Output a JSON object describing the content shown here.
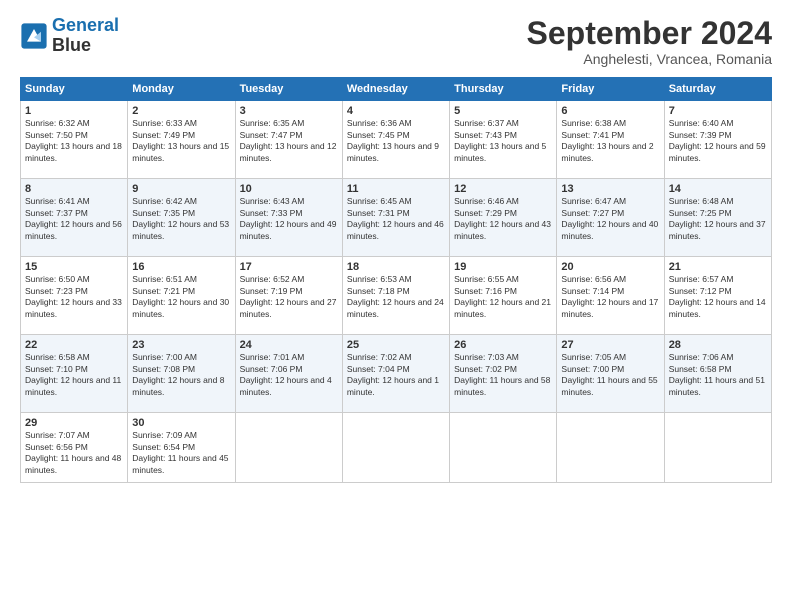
{
  "logo": {
    "line1": "General",
    "line2": "Blue"
  },
  "header": {
    "month": "September 2024",
    "location": "Anghelesti, Vrancea, Romania"
  },
  "weekdays": [
    "Sunday",
    "Monday",
    "Tuesday",
    "Wednesday",
    "Thursday",
    "Friday",
    "Saturday"
  ],
  "weeks": [
    [
      {
        "day": "1",
        "sunrise": "6:32 AM",
        "sunset": "7:50 PM",
        "daylight": "13 hours and 18 minutes."
      },
      {
        "day": "2",
        "sunrise": "6:33 AM",
        "sunset": "7:49 PM",
        "daylight": "13 hours and 15 minutes."
      },
      {
        "day": "3",
        "sunrise": "6:35 AM",
        "sunset": "7:47 PM",
        "daylight": "13 hours and 12 minutes."
      },
      {
        "day": "4",
        "sunrise": "6:36 AM",
        "sunset": "7:45 PM",
        "daylight": "13 hours and 9 minutes."
      },
      {
        "day": "5",
        "sunrise": "6:37 AM",
        "sunset": "7:43 PM",
        "daylight": "13 hours and 5 minutes."
      },
      {
        "day": "6",
        "sunrise": "6:38 AM",
        "sunset": "7:41 PM",
        "daylight": "13 hours and 2 minutes."
      },
      {
        "day": "7",
        "sunrise": "6:40 AM",
        "sunset": "7:39 PM",
        "daylight": "12 hours and 59 minutes."
      }
    ],
    [
      {
        "day": "8",
        "sunrise": "6:41 AM",
        "sunset": "7:37 PM",
        "daylight": "12 hours and 56 minutes."
      },
      {
        "day": "9",
        "sunrise": "6:42 AM",
        "sunset": "7:35 PM",
        "daylight": "12 hours and 53 minutes."
      },
      {
        "day": "10",
        "sunrise": "6:43 AM",
        "sunset": "7:33 PM",
        "daylight": "12 hours and 49 minutes."
      },
      {
        "day": "11",
        "sunrise": "6:45 AM",
        "sunset": "7:31 PM",
        "daylight": "12 hours and 46 minutes."
      },
      {
        "day": "12",
        "sunrise": "6:46 AM",
        "sunset": "7:29 PM",
        "daylight": "12 hours and 43 minutes."
      },
      {
        "day": "13",
        "sunrise": "6:47 AM",
        "sunset": "7:27 PM",
        "daylight": "12 hours and 40 minutes."
      },
      {
        "day": "14",
        "sunrise": "6:48 AM",
        "sunset": "7:25 PM",
        "daylight": "12 hours and 37 minutes."
      }
    ],
    [
      {
        "day": "15",
        "sunrise": "6:50 AM",
        "sunset": "7:23 PM",
        "daylight": "12 hours and 33 minutes."
      },
      {
        "day": "16",
        "sunrise": "6:51 AM",
        "sunset": "7:21 PM",
        "daylight": "12 hours and 30 minutes."
      },
      {
        "day": "17",
        "sunrise": "6:52 AM",
        "sunset": "7:19 PM",
        "daylight": "12 hours and 27 minutes."
      },
      {
        "day": "18",
        "sunrise": "6:53 AM",
        "sunset": "7:18 PM",
        "daylight": "12 hours and 24 minutes."
      },
      {
        "day": "19",
        "sunrise": "6:55 AM",
        "sunset": "7:16 PM",
        "daylight": "12 hours and 21 minutes."
      },
      {
        "day": "20",
        "sunrise": "6:56 AM",
        "sunset": "7:14 PM",
        "daylight": "12 hours and 17 minutes."
      },
      {
        "day": "21",
        "sunrise": "6:57 AM",
        "sunset": "7:12 PM",
        "daylight": "12 hours and 14 minutes."
      }
    ],
    [
      {
        "day": "22",
        "sunrise": "6:58 AM",
        "sunset": "7:10 PM",
        "daylight": "12 hours and 11 minutes."
      },
      {
        "day": "23",
        "sunrise": "7:00 AM",
        "sunset": "7:08 PM",
        "daylight": "12 hours and 8 minutes."
      },
      {
        "day": "24",
        "sunrise": "7:01 AM",
        "sunset": "7:06 PM",
        "daylight": "12 hours and 4 minutes."
      },
      {
        "day": "25",
        "sunrise": "7:02 AM",
        "sunset": "7:04 PM",
        "daylight": "12 hours and 1 minute."
      },
      {
        "day": "26",
        "sunrise": "7:03 AM",
        "sunset": "7:02 PM",
        "daylight": "11 hours and 58 minutes."
      },
      {
        "day": "27",
        "sunrise": "7:05 AM",
        "sunset": "7:00 PM",
        "daylight": "11 hours and 55 minutes."
      },
      {
        "day": "28",
        "sunrise": "7:06 AM",
        "sunset": "6:58 PM",
        "daylight": "11 hours and 51 minutes."
      }
    ],
    [
      {
        "day": "29",
        "sunrise": "7:07 AM",
        "sunset": "6:56 PM",
        "daylight": "11 hours and 48 minutes."
      },
      {
        "day": "30",
        "sunrise": "7:09 AM",
        "sunset": "6:54 PM",
        "daylight": "11 hours and 45 minutes."
      },
      null,
      null,
      null,
      null,
      null
    ]
  ]
}
